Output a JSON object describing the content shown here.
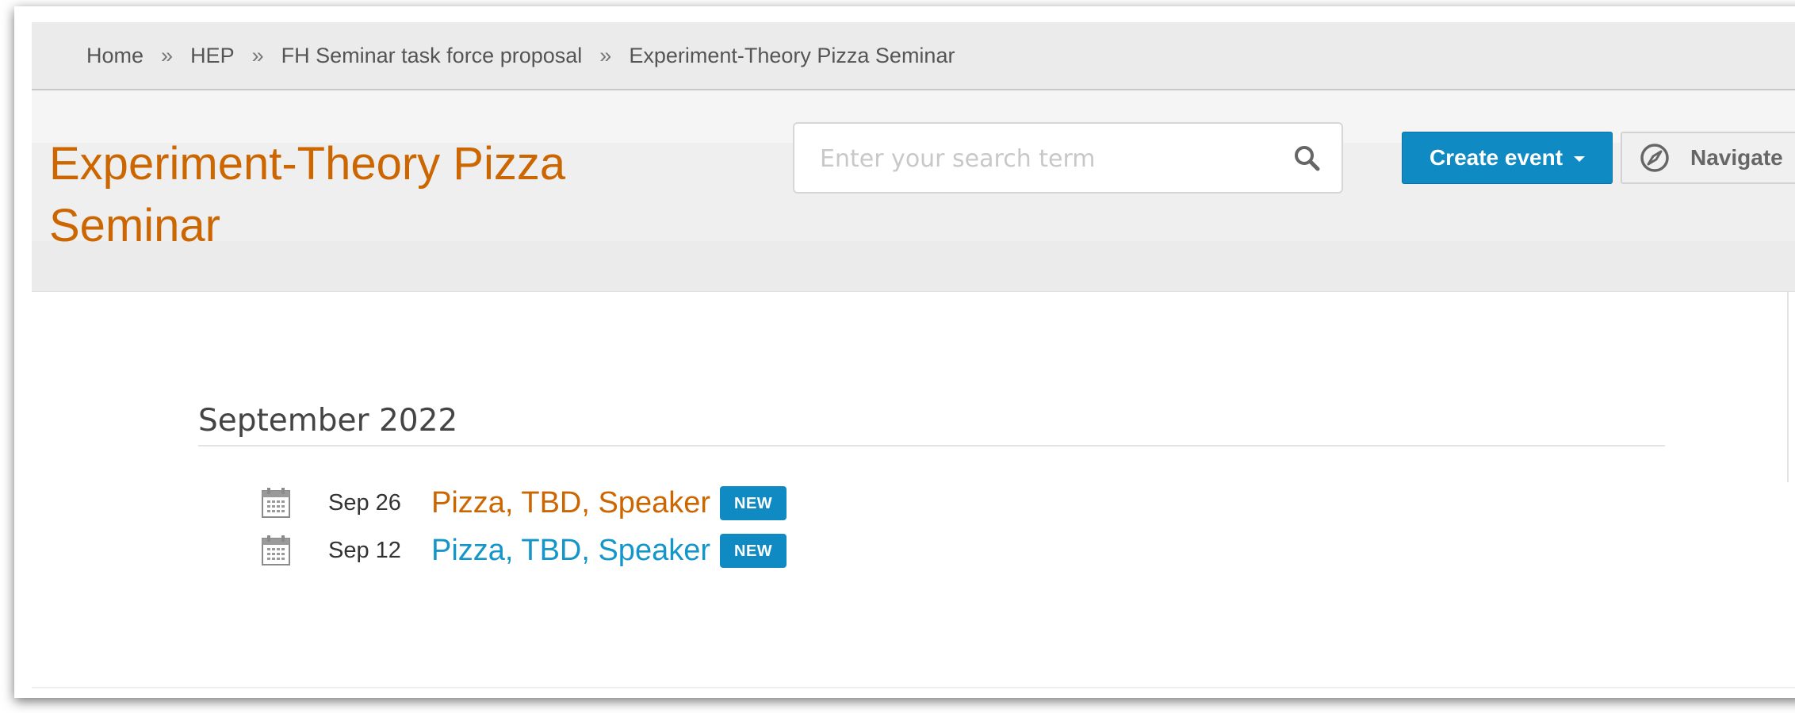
{
  "breadcrumb": {
    "items": [
      "Home",
      "HEP",
      "FH Seminar task force proposal",
      "Experiment-Theory Pizza Seminar"
    ],
    "separator": "»"
  },
  "header": {
    "title": "Experiment-Theory Pizza Seminar",
    "search_placeholder": "Enter your search term",
    "search_icon": "search-icon",
    "create_event_label": "Create event",
    "navigate_label": "Navigate",
    "navigate_icon": "compass-icon"
  },
  "events": {
    "month": "September 2022",
    "items": [
      {
        "date": "Sep 26",
        "title": "Pizza, TBD, Speaker",
        "badge": "NEW",
        "title_color": "#cc6600"
      },
      {
        "date": "Sep 12",
        "title": "Pizza, TBD, Speaker",
        "badge": "NEW",
        "title_color": "#1496c9"
      }
    ]
  },
  "colors": {
    "accent_orange": "#cc6600",
    "primary_blue": "#0f8ac2",
    "link_blue": "#1496c9"
  }
}
